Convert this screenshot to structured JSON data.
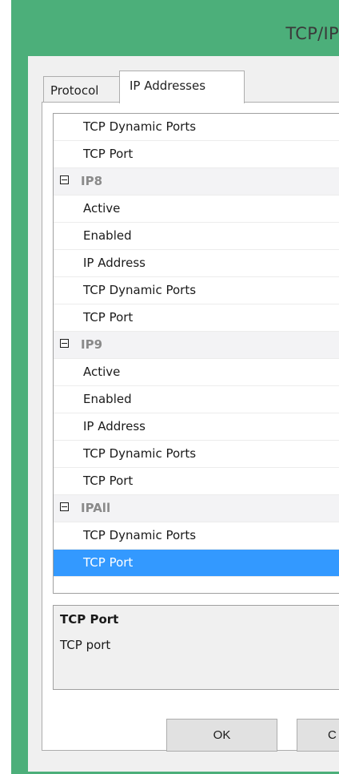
{
  "window": {
    "title": "TCP/IP"
  },
  "tabs": [
    {
      "label": "Protocol"
    },
    {
      "label": "IP Addresses"
    }
  ],
  "grid": {
    "rows": [
      {
        "label": "TCP Dynamic Ports",
        "type": "property"
      },
      {
        "label": "TCP Port",
        "type": "property"
      },
      {
        "label": "IP8",
        "type": "category"
      },
      {
        "label": "Active",
        "type": "property"
      },
      {
        "label": "Enabled",
        "type": "property"
      },
      {
        "label": "IP Address",
        "type": "property"
      },
      {
        "label": "TCP Dynamic Ports",
        "type": "property"
      },
      {
        "label": "TCP Port",
        "type": "property"
      },
      {
        "label": "IP9",
        "type": "category"
      },
      {
        "label": "Active",
        "type": "property"
      },
      {
        "label": "Enabled",
        "type": "property"
      },
      {
        "label": "IP Address",
        "type": "property"
      },
      {
        "label": "TCP Dynamic Ports",
        "type": "property"
      },
      {
        "label": "TCP Port",
        "type": "property"
      },
      {
        "label": "IPAll",
        "type": "category"
      },
      {
        "label": "TCP Dynamic Ports",
        "type": "property"
      },
      {
        "label": "TCP Port",
        "type": "property",
        "selected": true
      }
    ]
  },
  "description": {
    "title": "TCP Port",
    "text": "TCP port"
  },
  "buttons": {
    "ok": "OK",
    "cancel": "C"
  },
  "colors": {
    "frame": "#4caf7a",
    "selection": "#3399ff"
  },
  "icons": {
    "expander": "collapse-minus-icon"
  }
}
